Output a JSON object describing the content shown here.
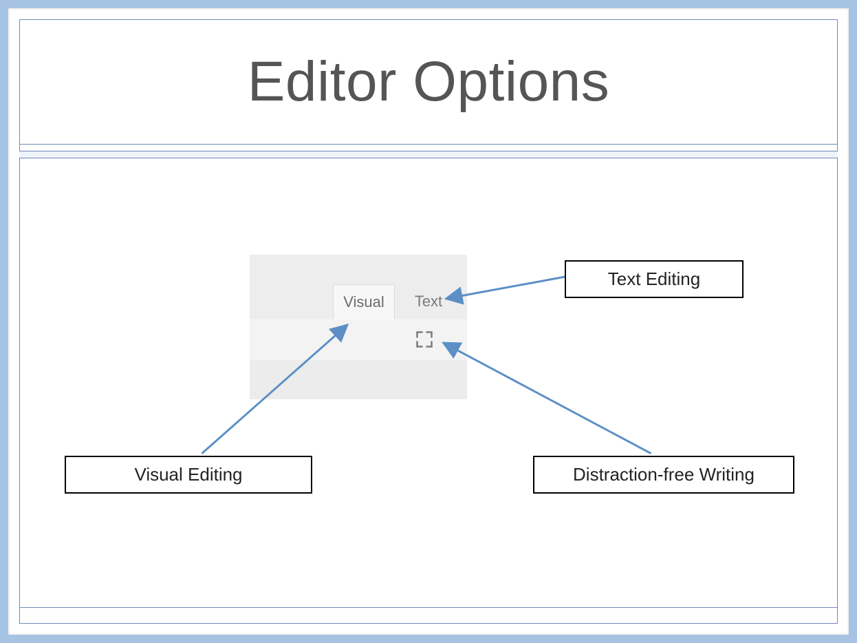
{
  "title": "Editor Options",
  "editor": {
    "tab_visual": "Visual",
    "tab_text": "Text"
  },
  "callouts": {
    "visual": "Visual Editing",
    "text": "Text Editing",
    "distraction_free": "Distraction-free Writing"
  }
}
